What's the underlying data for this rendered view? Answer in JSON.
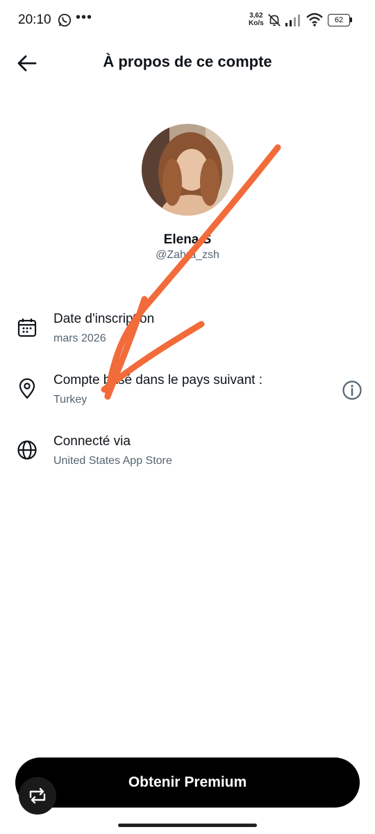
{
  "status_bar": {
    "time": "20:10",
    "network_speed_value": "3,62",
    "network_speed_unit": "Ko/s",
    "battery_level": "62",
    "icons": [
      "whatsapp-icon",
      "more-dots-icon",
      "mute-icon",
      "signal-icon",
      "wifi-icon",
      "battery-icon"
    ]
  },
  "header": {
    "title": "À propos de ce compte",
    "back_icon": "arrow-left-icon"
  },
  "profile": {
    "display_name": "Elena S",
    "handle": "@Zahra_zsh"
  },
  "info_rows": [
    {
      "icon": "calendar-icon",
      "title": "Date d'inscription",
      "value": "mars 2026"
    },
    {
      "icon": "location-pin-icon",
      "title": "Compte basé dans le pays suivant :",
      "value": "Turkey",
      "action_icon": "info-icon"
    },
    {
      "icon": "globe-icon",
      "title": "Connecté via",
      "value": "United States App Store"
    }
  ],
  "premium_button": {
    "label": "Obtenir Premium"
  },
  "colors": {
    "text_primary": "#0f1419",
    "text_secondary": "#536471",
    "button_background": "#000000",
    "annotation_arrow": "#f26b3a"
  }
}
